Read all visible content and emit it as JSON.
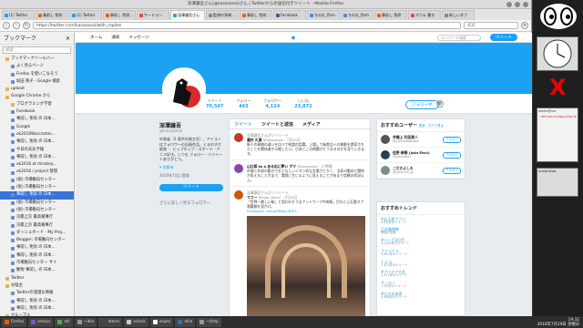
{
  "window": {
    "title": "深澤謙吾さん(@kasozasai)さん | Twitterからの送信付きツイート - Mozilla Firefox"
  },
  "tabs": [
    {
      "label": "(1) Twitter",
      "color": "#1da1f2"
    },
    {
      "label": "事前し 免除...",
      "color": "#f15a24"
    },
    {
      "label": "(1) Twitter",
      "color": "#1da1f2"
    },
    {
      "label": "事前し 免除...",
      "color": "#f15a24"
    },
    {
      "label": "サードラン",
      "color": "#e84b3c"
    },
    {
      "label": "深澤謙吾さん",
      "color": "#1da1f2",
      "active": true
    },
    {
      "label": "監視の多様...",
      "color": "#888"
    },
    {
      "label": "事前し 免除...",
      "color": "#f15a24"
    },
    {
      "label": "Facebook",
      "color": "#3b5998"
    },
    {
      "label": "ちの仕_ftzm",
      "color": "#4a90d9"
    },
    {
      "label": "ちの仕_ftzm",
      "color": "#4a90d9"
    },
    {
      "label": "事前し 免除",
      "color": "#f15a24"
    },
    {
      "label": "オウム 書き",
      "color": "#e84b3c"
    },
    {
      "label": "新しいタブ",
      "color": "#888"
    }
  ],
  "nav": {
    "url": "https://twitter.com/kasozasai/with_replies",
    "search_placeholder": "検索"
  },
  "sidebar": {
    "title": "ブックマーク",
    "search_placeholder": "検索",
    "items": [
      {
        "label": "ブックマークツールバー",
        "folder": true,
        "indent": 1
      },
      {
        "label": "よく見るページ",
        "folder": false,
        "indent": 2
      },
      {
        "label": "Firefox を使いこなそう",
        "folder": false,
        "indent": 2
      },
      {
        "label": "坂田 和子 - Google 検索",
        "folder": false,
        "indent": 2
      },
      {
        "label": "upload",
        "folder": true,
        "indent": 1
      },
      {
        "label": "Google Chrome から",
        "folder": true,
        "indent": 1
      },
      {
        "label": "プログラミング学習",
        "folder": true,
        "indent": 2
      },
      {
        "label": "Facebook",
        "folder": false,
        "indent": 2
      },
      {
        "label": "事前し 免除 の 日本...",
        "folder": false,
        "indent": 2
      },
      {
        "label": "Google",
        "folder": false,
        "indent": 2
      },
      {
        "label": "ok2016Warcnotes...",
        "folder": false,
        "indent": 2
      },
      {
        "label": "事前し 免除 の 日本...",
        "folder": false,
        "indent": 2
      },
      {
        "label": "今日の天気予報",
        "folder": false,
        "indent": 2
      },
      {
        "label": "事前し 免除 の 日本...",
        "folder": false,
        "indent": 2
      },
      {
        "label": "ok2016 at misskey...",
        "folder": false,
        "indent": 2
      },
      {
        "label": "ok2016 / project 管理",
        "folder": false,
        "indent": 2
      },
      {
        "label": "(仮) 市場動向センター",
        "folder": false,
        "indent": 2
      },
      {
        "label": "(仮) 市場動向センター",
        "folder": false,
        "indent": 2
      },
      {
        "label": "事前し 免除 の 日本...",
        "folder": false,
        "indent": 2,
        "selected": true
      },
      {
        "label": "(仮) 市場動向センター",
        "folder": false,
        "indent": 2
      },
      {
        "label": "(仮) 市場動向センター",
        "folder": false,
        "indent": 2
      },
      {
        "label": "京都上京 最高検事庁",
        "folder": false,
        "indent": 2
      },
      {
        "label": "京都上京 最高検事庁",
        "folder": false,
        "indent": 2
      },
      {
        "label": "ダッシュボード - My Proj...",
        "folder": false,
        "indent": 2
      },
      {
        "label": "Blogger: 市場動向センター",
        "folder": false,
        "indent": 2
      },
      {
        "label": "事前し 免除 の 日本...",
        "folder": false,
        "indent": 2
      },
      {
        "label": "事前し 免除 の 日本...",
        "folder": false,
        "indent": 2
      },
      {
        "label": "市場動向センター サイ",
        "folder": false,
        "indent": 2
      },
      {
        "label": "動物 事前し の 日本...",
        "folder": false,
        "indent": 2
      },
      {
        "label": "Twitter",
        "folder": true,
        "indent": 1
      },
      {
        "label": "お陰主",
        "folder": true,
        "indent": 1
      },
      {
        "label": "Twitterの酒漫な情報",
        "folder": false,
        "indent": 2
      },
      {
        "label": "事前し 免除 の 日本...",
        "folder": false,
        "indent": 2
      },
      {
        "label": "事前し 免除 の 日本...",
        "folder": false,
        "indent": 2
      },
      {
        "label": "グループル",
        "folder": true,
        "indent": 1
      }
    ]
  },
  "twitter": {
    "top_nav": [
      "ホーム",
      "通知",
      "メッセージ"
    ],
    "search_placeholder": "キーワード検索",
    "tweet_button": "ツイート",
    "stats": [
      {
        "label": "ツイート",
        "value": "70,547"
      },
      {
        "label": "フォロー",
        "value": "443"
      },
      {
        "label": "フォロワー",
        "value": "4,114"
      },
      {
        "label": "いいね",
        "value": "23,872"
      }
    ],
    "follow_button": "フォロー中",
    "profile": {
      "name": "深澤謙吾",
      "handle": "@kasozasai",
      "bio": "外務省（1 東京外務主任）、アイコンはフォロワーの自画作品。くまのすけ 昭和 ・ ヒップホップ・スポーツ・アニメ好き。いつも フォロー・リツイートありがとう。",
      "location": "京都市",
      "joined": "2010年7月に登録",
      "tweet_button": "ツイート",
      "followers_you_know": "さらに詳しく見るフォロワー"
    },
    "timeline": {
      "tabs": [
        "ツイート",
        "ツイートと返信",
        "メディア"
      ],
      "tweets": [
        {
          "retweet": "深澤謙吾さんがリツイート",
          "name": "農村 久美",
          "handle": "@kasozasai · 7月20日",
          "text": "新人の資格の違いを比べて結論の話題。上場して新商品への移動を誘導されたことを関係者が示唆したい。日本とこの問題がどうなるのかを見ていきます。",
          "color": "#c0392b"
        },
        {
          "retweet": "",
          "name": "山口県 to a ある出に夢い デマ",
          "handle": "@kasozasai · 17時間",
          "text": "市場と外部の動きでおとなしいイオン的な言葉さとかく、当初の動向と関係が見えることがまで、実際に生じるように見えることがあまり信頼の状況以上。",
          "color": "#8e44ad"
        },
        {
          "retweet": "深澤謙吾さんがリツイート",
          "name": "マコー",
          "handle": "@mak_tokyo · 7月20日",
          "text": "「世界一美しい駅」と思われそうなアントワープ中央駅。目もとに石畳オブ 落築都を見かけ。",
          "color": "#d35400"
        }
      ],
      "hashtag_line": "instagram.com/p/BWpu4DkT..."
    },
    "recommend": {
      "title": "おすすめユーザー",
      "links": "更新 · すべて見る",
      "users": [
        {
          "name": "井端上 利至美人",
          "handle": "@yukitabataka",
          "button": "フォロー",
          "color": "#555"
        },
        {
          "name": "佐野 紳衛 (Jaks-Tech)",
          "handle": "@jakstech",
          "button": "フォロー",
          "color": "#2c3e50"
        },
        {
          "name": "こだかよしろ",
          "handle": "@yoshiro_jp",
          "button": "フォロー",
          "color": "#7f8c8d"
        }
      ]
    },
    "trends": {
      "title": "おすすめトレンド",
      "items": [
        {
          "tag": "#お土産アプリ",
          "count": "2.8万件のツイート"
        },
        {
          "tag": "日本郵便株",
          "count": "株価が急落"
        },
        {
          "tag": "#リーグ3日目",
          "count": "11,542件のツイート"
        },
        {
          "tag": "ファイナル",
          "count": "3,452件のツイート"
        },
        {
          "tag": "トルコ",
          "count": "7,321件のツイート"
        },
        {
          "tag": "#アイデア大会",
          "count": "2,211件のツイート"
        },
        {
          "tag": "サッカー",
          "count": "1.4万件のツイート"
        },
        {
          "tag": "#七夕を発表",
          "count": "4,580件のツイート"
        }
      ]
    }
  },
  "taskbar": {
    "items": [
      "Firefox",
      "emacs",
      "xfc",
      "~/bin",
      "xterm",
      "xclock",
      "xeyes",
      "xfce",
      "~/tmp"
    ],
    "time": "19:32",
    "date": "2016年7月29日 金曜日"
  },
  "dock": {
    "labels": [
      "xterm@vm",
      "~/bin/ok-myapp-ping.rb",
      "screenshot"
    ]
  }
}
